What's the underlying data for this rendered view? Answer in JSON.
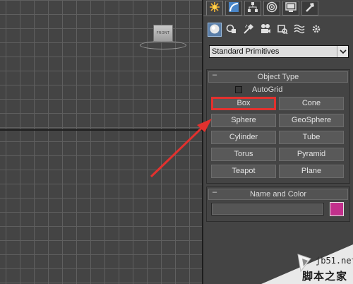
{
  "viewport": {
    "viewcube_label": "FRONT"
  },
  "command_panel": {
    "tabs": [
      "create-icon",
      "modify-icon",
      "hierarchy-icon",
      "motion-icon",
      "display-icon",
      "utilities-icon"
    ],
    "categories": [
      "geometry-icon",
      "shapes-icon",
      "lights-icon",
      "cameras-icon",
      "helpers-icon",
      "space-warps-icon",
      "systems-icon"
    ],
    "dropdown_value": "Standard Primitives",
    "object_type": {
      "title": "Object Type",
      "toggle": "–",
      "autogrid_label": "AutoGrid",
      "buttons": [
        "Box",
        "Cone",
        "Sphere",
        "GeoSphere",
        "Cylinder",
        "Tube",
        "Torus",
        "Pyramid",
        "Teapot",
        "Plane"
      ]
    },
    "name_and_color": {
      "title": "Name and Color",
      "toggle": "–",
      "name_value": "",
      "swatch_color": "#c2308c"
    }
  },
  "annotation": {
    "highlight_color": "#e2312e"
  },
  "watermark": {
    "site": "jb51.net",
    "text": "脚本之家"
  }
}
